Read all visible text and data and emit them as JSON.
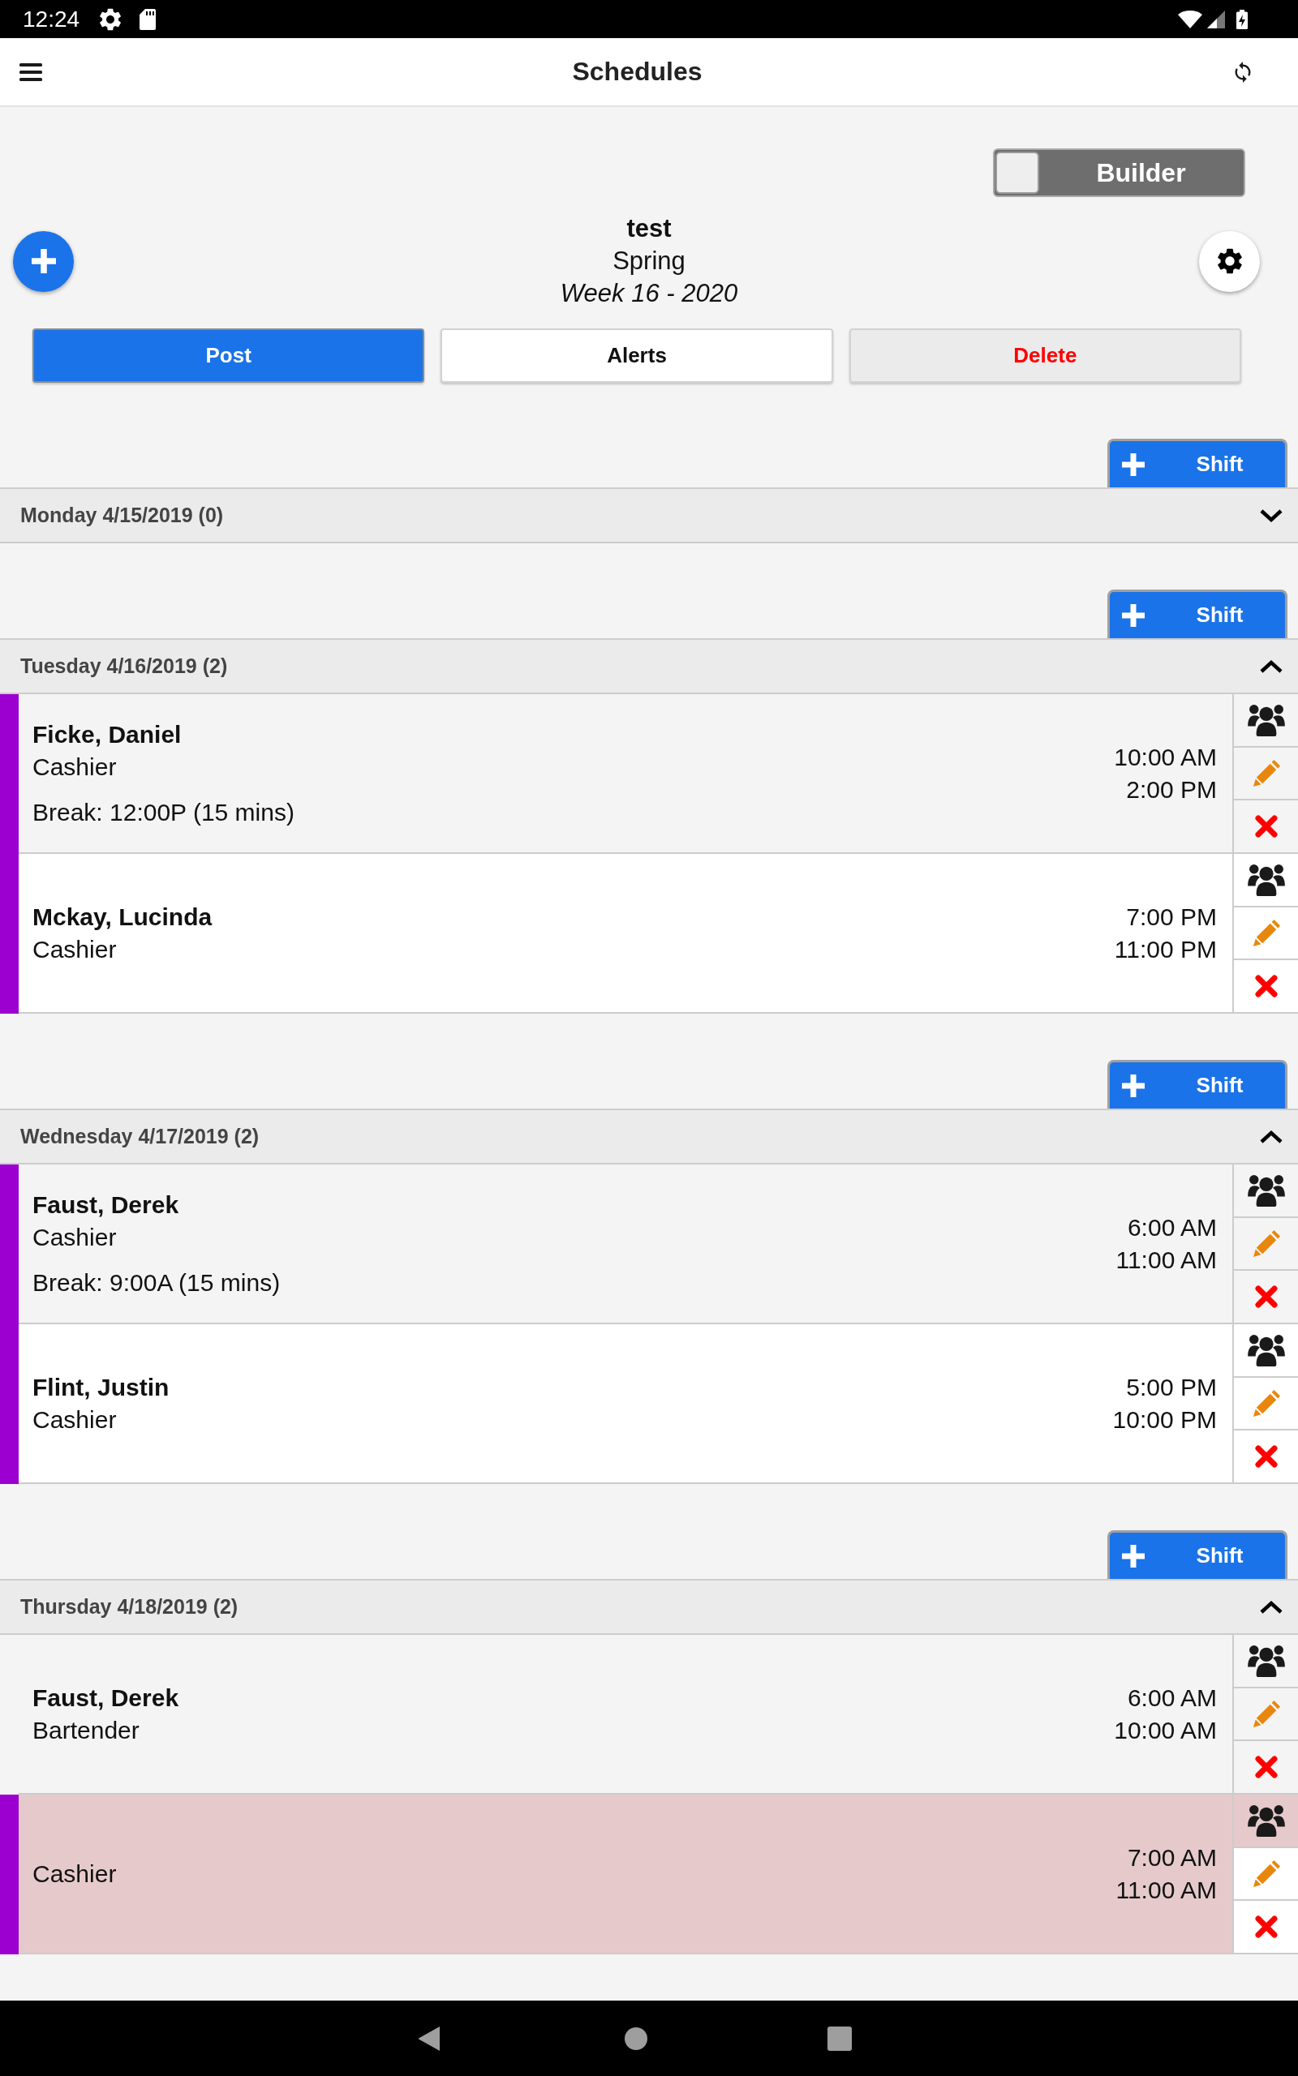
{
  "status_bar": {
    "time": "12:24"
  },
  "app_bar": {
    "title": "Schedules"
  },
  "builder_toggle": {
    "label": "Builder",
    "on": false
  },
  "schedule": {
    "name": "test",
    "season": "Spring",
    "week": "Week 16 - 2020"
  },
  "actions": [
    {
      "label": "Post",
      "kind": "primary"
    },
    {
      "label": "Alerts",
      "kind": "plain"
    },
    {
      "label": "Delete",
      "kind": "danger"
    }
  ],
  "days": [
    {
      "title": "Monday 4/15/2019 (0)",
      "add_shift": "Shift",
      "expanded": false
    },
    {
      "title": "Tuesday 4/16/2019 (2)",
      "add_shift": "Shift",
      "expanded": true,
      "shifts": [
        {
          "employee": "Ficke, Daniel",
          "position": "Cashier",
          "break": "Break: 12:00P (15 mins)",
          "start": "10:00 AM",
          "end": "2:00 PM",
          "color": "#9b00d0",
          "open": false
        },
        {
          "employee": "Mckay, Lucinda",
          "position": "Cashier",
          "start": "7:00 PM",
          "end": "11:00 PM",
          "color": "#9b00d0",
          "open": false
        }
      ]
    },
    {
      "title": "Wednesday 4/17/2019 (2)",
      "add_shift": "Shift",
      "expanded": true,
      "shifts": [
        {
          "employee": "Faust, Derek",
          "position": "Cashier",
          "break": "Break: 9:00A (15 mins)",
          "start": "6:00 AM",
          "end": "11:00 AM",
          "color": "#9b00d0",
          "open": false
        },
        {
          "employee": "Flint, Justin",
          "position": "Cashier",
          "start": "5:00 PM",
          "end": "10:00 PM",
          "color": "#9b00d0",
          "open": false
        }
      ]
    },
    {
      "title": "Thursday 4/18/2019 (2)",
      "add_shift": "Shift",
      "expanded": true,
      "shifts": [
        {
          "employee": "Faust, Derek",
          "position": "Bartender",
          "start": "6:00 AM",
          "end": "10:00 AM",
          "open": false
        },
        {
          "position": "Cashier",
          "start": "7:00 AM",
          "end": "11:00 AM",
          "color": "#9b00d0",
          "open": true
        }
      ]
    }
  ]
}
